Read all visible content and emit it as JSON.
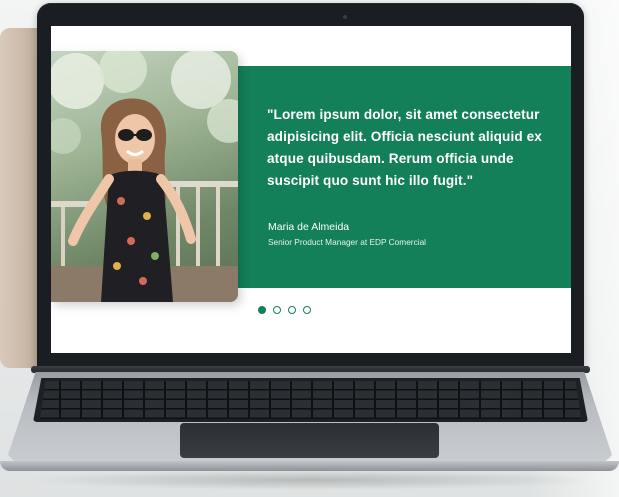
{
  "testimonial": {
    "quote": "\"Lorem ipsum dolor, sit amet consectetur adipisicing elit. Officia nesciunt aliquid ex atque quibusdam. Rerum officia unde suscipit quo sunt hic illo fugit.\"",
    "author_name": "Maria de Almeida",
    "author_role": "Senior Product Manager at EDP Comercial"
  },
  "carousel": {
    "slide_count": 4,
    "active_index": 0
  },
  "colors": {
    "accent_green": "#138059",
    "screen_background": "#ffffff"
  }
}
